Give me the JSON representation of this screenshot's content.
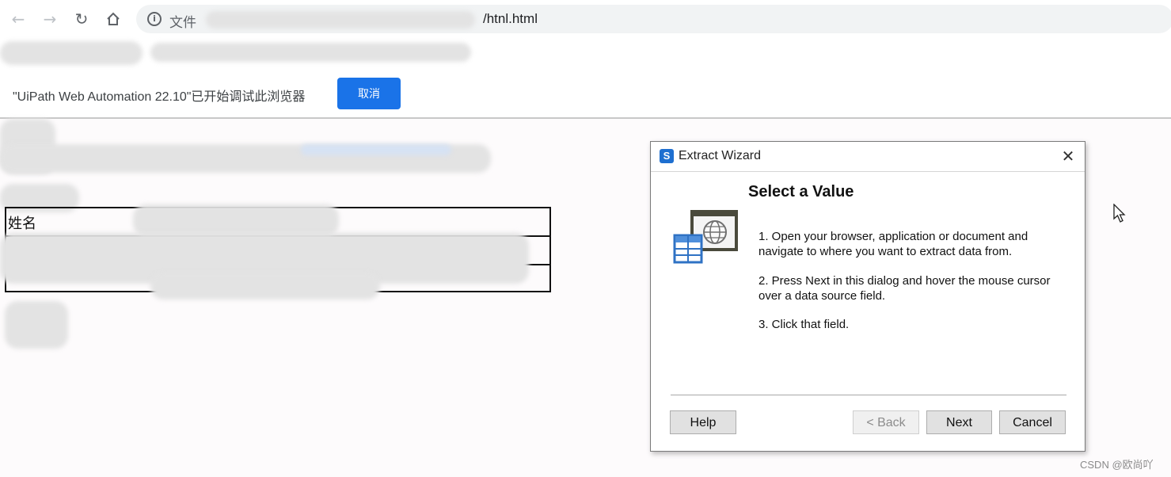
{
  "browser": {
    "back_icon": "arrow-left-icon",
    "forward_icon": "arrow-right-icon",
    "reload_icon": "reload-icon",
    "home_icon": "home-icon",
    "info_icon": "info-icon",
    "url_scheme_label": "文件",
    "url_tail": "/htnl.html"
  },
  "infobar": {
    "message": "\"UiPath Web Automation 22.10\"已开始调试此浏览器",
    "cancel_label": "取消",
    "accent": "#1a73e8"
  },
  "page": {
    "table_header": "姓名"
  },
  "dialog": {
    "title": "Extract Wizard",
    "heading": "Select a Value",
    "steps": [
      "1. Open your browser, application or document and navigate to where you want to extract data from.",
      "2. Press Next in this dialog and hover the mouse cursor over a data source field.",
      "3. Click that field."
    ],
    "buttons": {
      "help": "Help",
      "back": "< Back",
      "next": "Next",
      "cancel": "Cancel"
    }
  },
  "watermark": "CSDN @欧尚吖"
}
